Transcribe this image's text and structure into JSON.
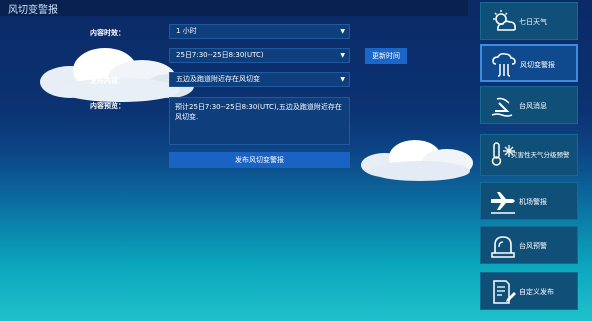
{
  "header": {
    "title": "风切变警报"
  },
  "form": {
    "validity": {
      "label": "内容时效：",
      "value": "1 小时"
    },
    "publish_time": {
      "label": "发布时间：",
      "value": "25日7:30--25日8:30(UTC)",
      "update_button": "更新时间"
    },
    "content": {
      "label": "发布内容：",
      "value": "五边及跑道附近存在风切变"
    },
    "preview": {
      "label": "内容预览：",
      "text": "预计25日7:30--25日8:30(UTC),五边及跑道附近存在风切变."
    },
    "submit_button": "发布风切变警报"
  },
  "sidebar": {
    "items": [
      {
        "label": "七日天气",
        "icon": "sun-cloud-icon"
      },
      {
        "label": "风切变警报",
        "icon": "wind-shear-icon"
      },
      {
        "label": "台风消息",
        "icon": "typhoon-icon"
      },
      {
        "label": "灾害性天气分级预警",
        "icon": "thermometer-snow-icon"
      },
      {
        "label": "机场警报",
        "icon": "airplane-icon"
      },
      {
        "label": "台风预警",
        "icon": "siren-icon"
      },
      {
        "label": "自定义发布",
        "icon": "document-edit-icon"
      }
    ]
  }
}
